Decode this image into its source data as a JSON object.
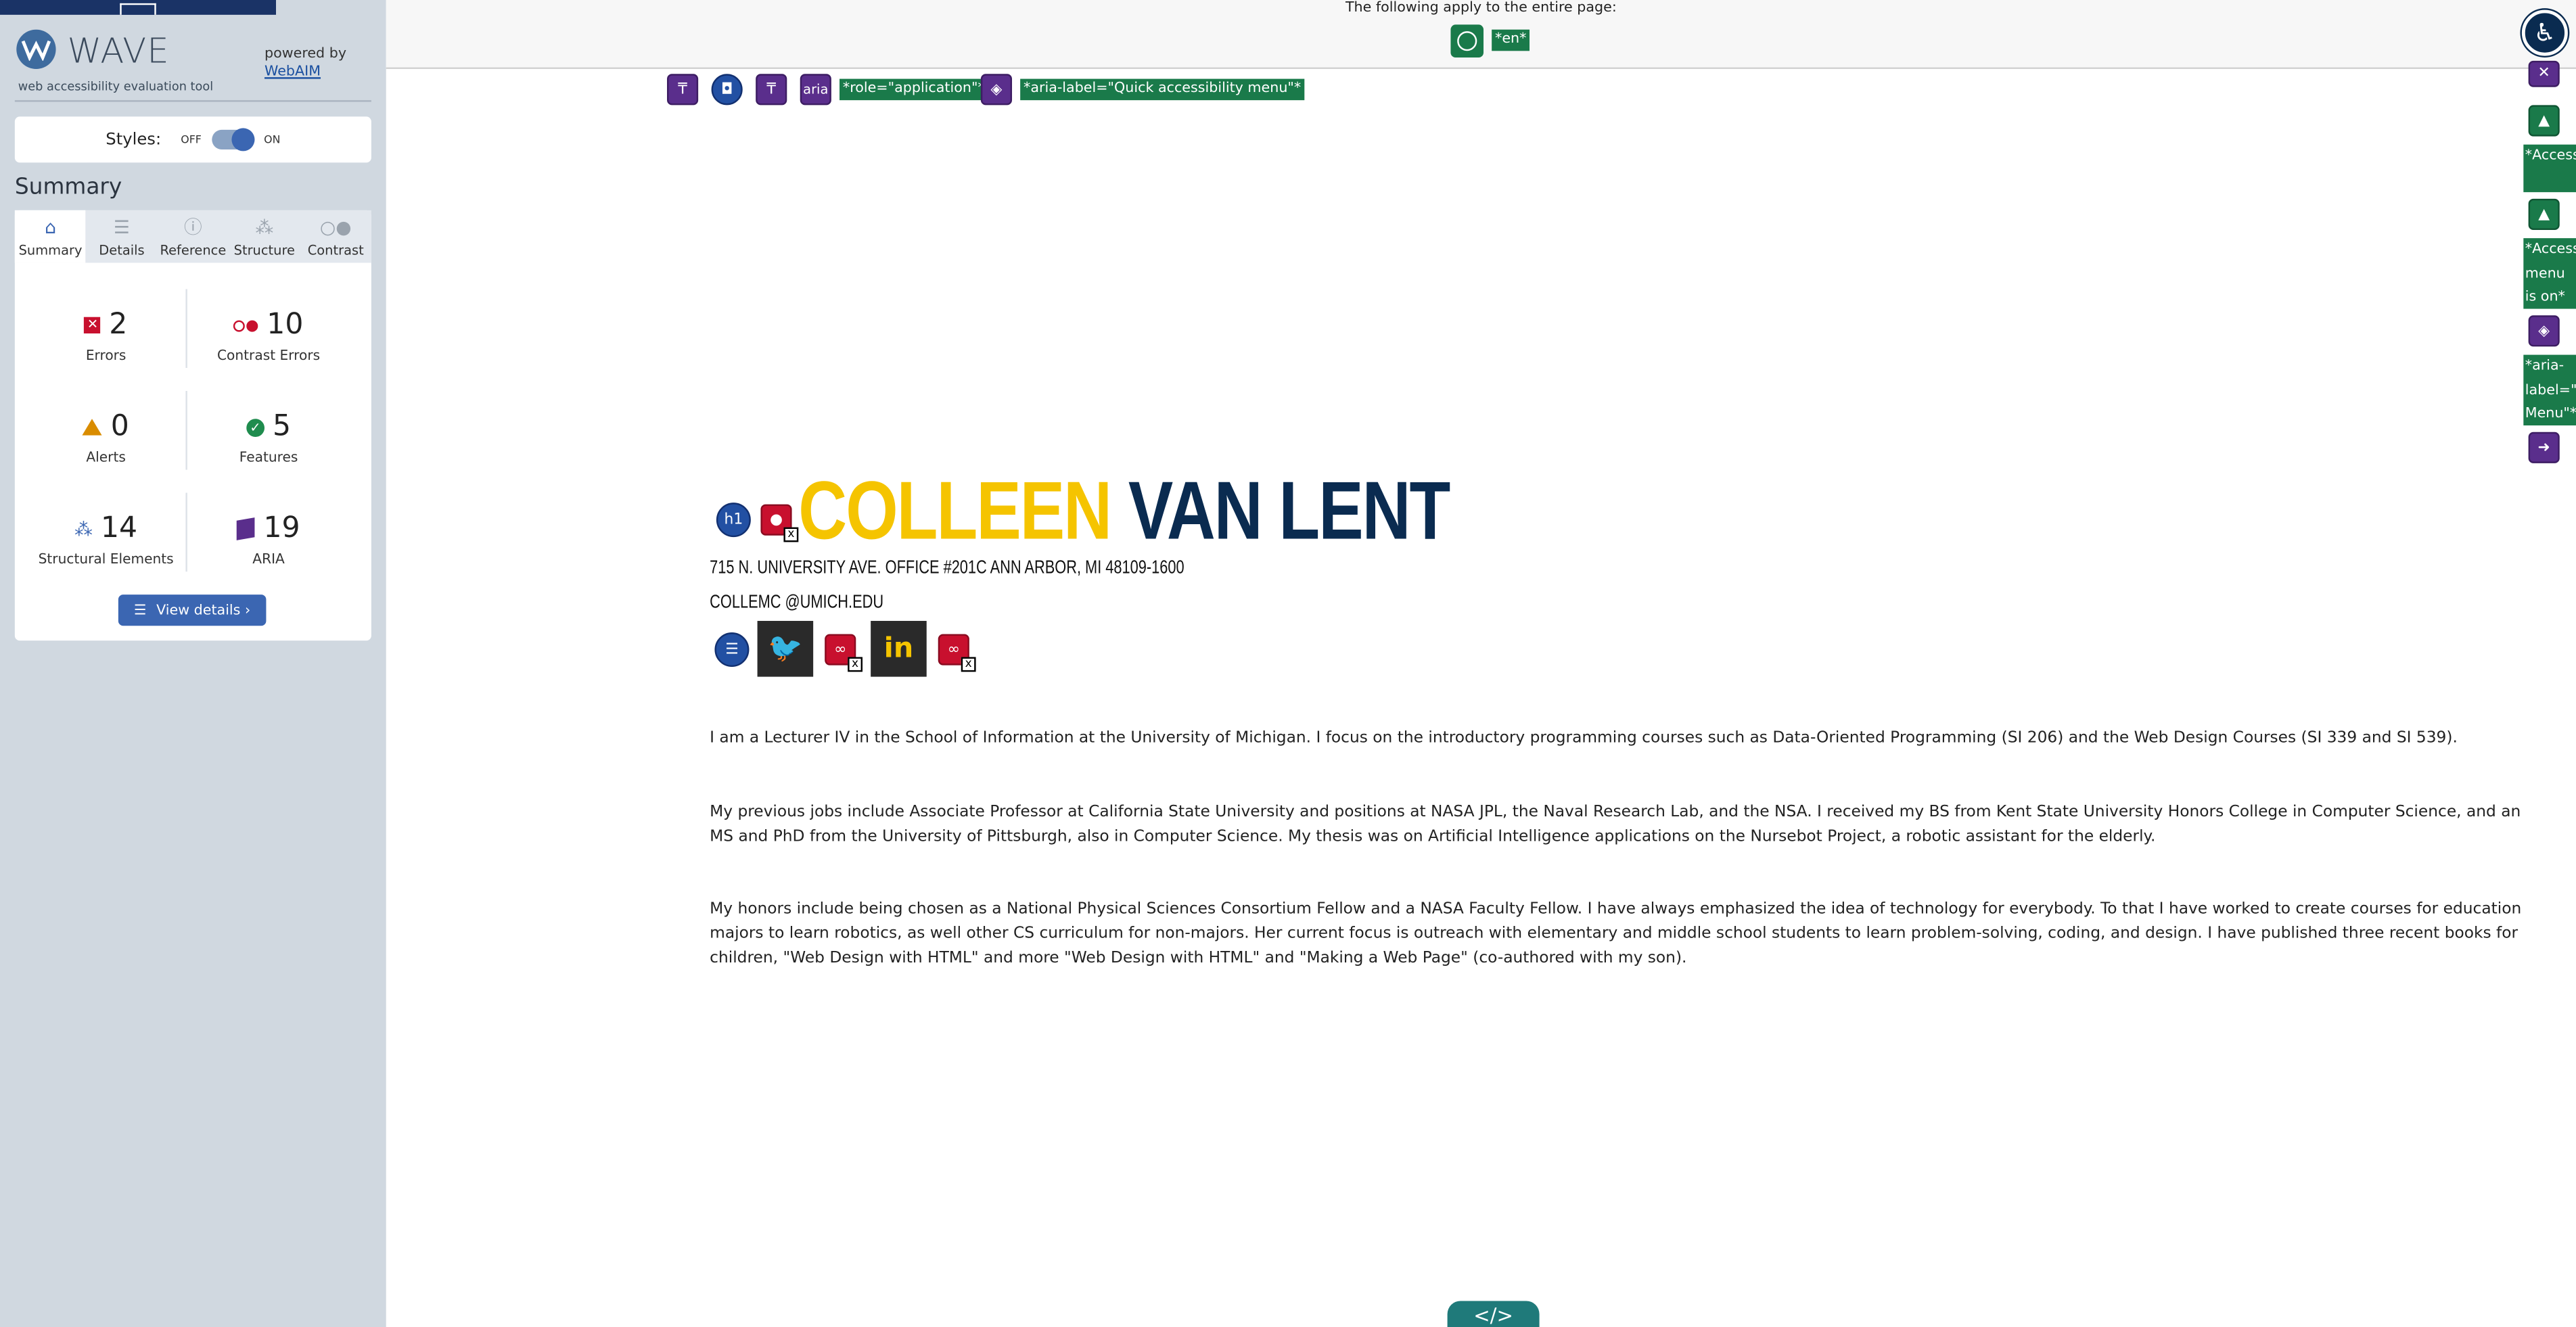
{
  "sidebar": {
    "title": "WAVE",
    "subtitle": "web accessibility evaluation tool",
    "powered_by": "powered by",
    "webaim_link": "WebAIM",
    "styles_label": "Styles:",
    "toggle_off": "OFF",
    "toggle_on": "ON",
    "summary_heading": "Summary",
    "tabs": [
      {
        "label": "Summary",
        "icon": "home-icon"
      },
      {
        "label": "Details",
        "icon": "list-icon"
      },
      {
        "label": "Reference",
        "icon": "info-icon"
      },
      {
        "label": "Structure",
        "icon": "sitemap-icon"
      },
      {
        "label": "Contrast",
        "icon": "contrast-icon"
      }
    ],
    "stats": {
      "errors": {
        "value": "2",
        "label": "Errors"
      },
      "contrast_errors": {
        "value": "10",
        "label": "Contrast Errors"
      },
      "alerts": {
        "value": "0",
        "label": "Alerts"
      },
      "features": {
        "value": "5",
        "label": "Features"
      },
      "structural": {
        "value": "14",
        "label": "Structural Elements"
      },
      "aria": {
        "value": "19",
        "label": "ARIA"
      }
    },
    "view_details": "View details ›"
  },
  "topbar": {
    "note": "The following apply to the entire page:",
    "lang_tag": "*en*"
  },
  "icon_row": {
    "role_tag": "*role=\"application\"*",
    "aria_label_tag": "*aria-label=\"Quick accessibility menu\"*",
    "aria_text": "aria"
  },
  "right_column": {
    "tag1": "*Access Widget*",
    "tag2": "*Access menu is on*",
    "tag3": "*aria- label=\"A Menu\"*"
  },
  "main": {
    "h1_badge": "h1",
    "name_first": "COLLEEN",
    "name_last": "VAN LENT",
    "address": "715 N. UNIVERSITY AVE. OFFICE #201C ANN ARBOR, MI 48109-1600",
    "email": "COLLEMC @UMICH.EDU",
    "paragraphs": [
      "I am a Lecturer IV in the School of Information at the University of Michigan. I focus on the introductory programming courses such as Data-Oriented Programming (SI 206) and the Web Design Courses (SI 339 and SI 539).",
      "My previous jobs include Associate Professor at California State University and positions at NASA JPL, the Naval Research Lab, and the NSA. I received my BS from Kent State University Honors College in Computer Science, and an MS and PhD from the University of Pittsburgh, also in Computer Science. My thesis was on Artificial Intelligence applications on the Nursebot Project, a robotic assistant for the elderly.",
      "My honors include being chosen as a National Physical Sciences Consortium Fellow and a NASA Faculty Fellow. I have always emphasized the idea of technology for everybody. To that I have worked to create courses for education majors to learn robotics, as well other CS curriculum for non-majors. Her current focus is outreach with elementary and middle school students to learn problem-solving, coding, and design. I have published three recent books for children, \"Web Design with HTML\" and more \"Web Design with HTML\" and \"Making a Web Page\" (co-authored with my son)."
    ],
    "code_button": "</>"
  },
  "colors": {
    "sidebar_bg": "#d0d8e0",
    "accent_blue": "#3b66b2",
    "error_red": "#c8102e",
    "aria_purple": "#5a2e8c",
    "feature_green": "#1a7a4a",
    "name_yellow": "#f5c400",
    "name_navy": "#0a2b50"
  }
}
